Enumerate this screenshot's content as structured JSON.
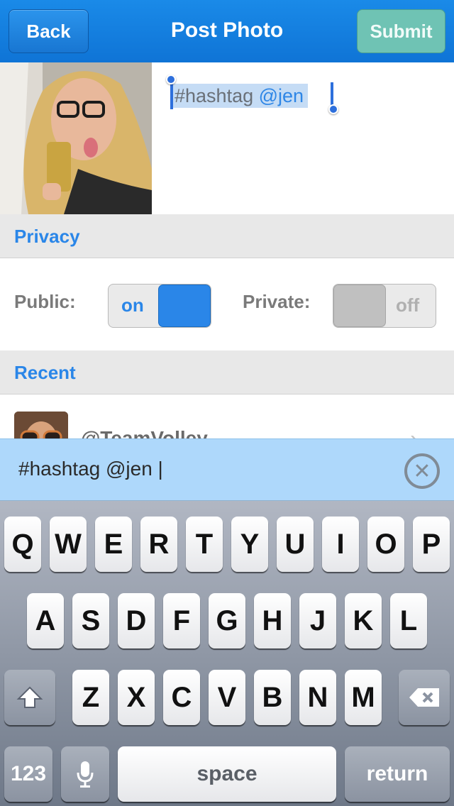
{
  "nav": {
    "back_label": "Back",
    "title": "Post Photo",
    "submit_label": "Submit"
  },
  "caption": {
    "hashtag": "#hashtag",
    "mention": "@jen"
  },
  "privacy": {
    "header": "Privacy",
    "public_label": "Public:",
    "public_state": "on",
    "private_label": "Private:",
    "private_state": "off"
  },
  "recent": {
    "header": "Recent",
    "items": [
      {
        "name": "@TeamVolley"
      }
    ]
  },
  "input": {
    "text": "#hashtag @jen |"
  },
  "keyboard": {
    "row1": [
      "Q",
      "W",
      "E",
      "R",
      "T",
      "Y",
      "U",
      "I",
      "O",
      "P"
    ],
    "row2": [
      "A",
      "S",
      "D",
      "F",
      "G",
      "H",
      "J",
      "K",
      "L"
    ],
    "row3": [
      "Z",
      "X",
      "C",
      "V",
      "B",
      "N",
      "M"
    ],
    "numbers_label": "123",
    "space_label": "space",
    "return_label": "return"
  },
  "colors": {
    "accent": "#1a84e4",
    "submit": "#6fc3b4",
    "input_bar": "#aed8fb"
  }
}
